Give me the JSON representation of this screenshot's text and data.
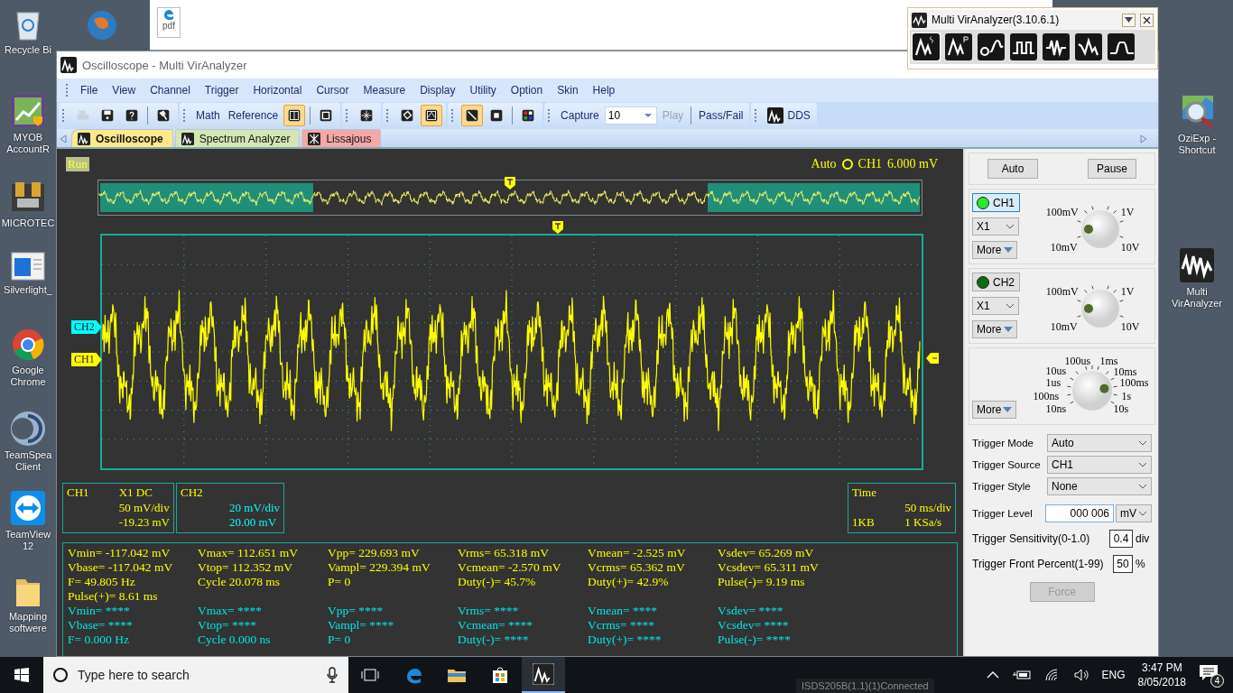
{
  "desktop": {
    "icons_left": [
      {
        "kind": "recycle",
        "label": "Recycle Bi"
      },
      {
        "kind": "chart",
        "label": "MYOB AccountR"
      },
      {
        "kind": "device",
        "label": "MICROTEC"
      },
      {
        "kind": "window",
        "label": "Silverlight_"
      },
      {
        "kind": "browser",
        "label": "Google Chrome"
      },
      {
        "kind": "headset",
        "label": "TeamSpea Client"
      },
      {
        "kind": "remote",
        "label": "TeamView 12"
      },
      {
        "kind": "folder",
        "label": "Mapping softwere"
      }
    ],
    "icons_right": [
      {
        "kind": "map",
        "label": "OziExp - Shortcut"
      },
      {
        "kind": "analyzer",
        "label": "Multi VirAnalyzer"
      }
    ],
    "file_icon": {
      "label": "pdf"
    }
  },
  "window": {
    "title": "Oscilloscope - Multi VirAnalyzer",
    "menu": [
      "File",
      "View",
      "Channel",
      "Trigger",
      "Horizontal",
      "Cursor",
      "Measure",
      "Display",
      "Utility",
      "Option",
      "Skin",
      "Help"
    ],
    "toolbar": [
      {
        "items": [
          {
            "kind": "icon",
            "pressed": false,
            "disabled": true
          },
          {
            "kind": "icon",
            "pressed": false,
            "disabled": false
          },
          {
            "kind": "icon",
            "pressed": false,
            "disabled": false
          },
          {
            "kind": "sep"
          },
          {
            "kind": "icon",
            "pressed": false,
            "disabled": false
          }
        ]
      },
      {
        "items": [
          {
            "kind": "text",
            "label": "Math",
            "disabled": false
          },
          {
            "kind": "text",
            "label": "Reference",
            "disabled": false
          },
          {
            "kind": "icon",
            "pressed": true,
            "disabled": false
          },
          {
            "kind": "sep"
          },
          {
            "kind": "icon",
            "pressed": false,
            "disabled": false
          }
        ]
      },
      {
        "items": [
          {
            "kind": "icon",
            "pressed": false,
            "disabled": false
          }
        ]
      },
      {
        "items": [
          {
            "kind": "icon",
            "pressed": false,
            "disabled": false
          },
          {
            "kind": "icon",
            "pressed": true,
            "disabled": false
          }
        ]
      },
      {
        "items": [
          {
            "kind": "icon",
            "pressed": true,
            "disabled": false
          },
          {
            "kind": "icon",
            "pressed": false,
            "disabled": false
          },
          {
            "kind": "sep"
          },
          {
            "kind": "icon",
            "pressed": false,
            "disabled": false
          }
        ]
      },
      {
        "items": [
          {
            "kind": "text",
            "label": "Capture",
            "disabled": false
          },
          {
            "kind": "input",
            "value": "10"
          },
          {
            "kind": "text",
            "label": "Play",
            "disabled": true
          },
          {
            "kind": "sep"
          },
          {
            "kind": "text",
            "label": "Pass/Fail",
            "disabled": false
          }
        ]
      },
      {
        "items": [
          {
            "kind": "icontext",
            "label": "DDS",
            "disabled": false
          }
        ]
      }
    ],
    "tabs": [
      {
        "label": "Oscilloscope",
        "selected": true,
        "color": "#fce98c"
      },
      {
        "label": "Spectrum Analyzer",
        "selected": false,
        "color": "#d4e6b5"
      },
      {
        "label": "Lissajous",
        "selected": false,
        "color": "#f4a8a8"
      }
    ],
    "scope": {
      "run_label": "Run",
      "trigger_mode": "Auto",
      "trigger_channel": "CH1",
      "trigger_value": "6.000 mV",
      "markers": [
        {
          "label": "CH2",
          "color": "#00ffff"
        },
        {
          "label": "CH1",
          "color": "#ffff00"
        }
      ],
      "channel_boxes": [
        {
          "title": "CH1",
          "coupling": "X1  DC",
          "scale": "50 mV/div",
          "offset": "-19.23 mV",
          "color": "#ffff00"
        },
        {
          "title": "CH2",
          "scale": "20 mV/div",
          "offset": "20.00 mV",
          "color": "#00ffff"
        }
      ],
      "time_box": {
        "title": "Time",
        "scale": "50 ms/div",
        "depth": "1KB",
        "rate": "1 KSa/s"
      },
      "measurements": [
        {
          "color": "#ffff00",
          "rows": [
            [
              "Vmin= -117.042 mV",
              "Vmax= 112.651 mV",
              "Vpp= 229.693 mV",
              "Vrms= 65.318 mV",
              "Vmean= -2.525 mV",
              "Vsdev= 65.269 mV"
            ],
            [
              "Vbase= -117.042 mV",
              "Vtop= 112.352 mV",
              "Vampl= 229.394 mV",
              "Vcmean= -2.570 mV",
              "Vcrms= 65.362 mV",
              "Vcsdev= 65.311 mV"
            ],
            [
              "F= 49.805 Hz",
              "Cycle 20.078 ms",
              "P= 0",
              "Duty(-)= 45.7%",
              "Duty(+)= 42.9%",
              "Pulse(-)= 9.19 ms"
            ],
            [
              "Pulse(+)= 8.61 ms"
            ]
          ]
        },
        {
          "color": "#00e8e8",
          "rows": [
            [
              "Vmin= ****",
              "Vmax= ****",
              "Vpp= ****",
              "Vrms= ****",
              "Vmean= ****",
              "Vsdev= ****"
            ],
            [
              "Vbase= ****",
              "Vtop= ****",
              "Vampl= ****",
              "Vcmean= ****",
              "Vcrms= ****",
              "Vcsdev= ****"
            ],
            [
              "F= 0.000 Hz",
              "Cycle 0.000 ns",
              "P= 0",
              "Duty(-)= ****",
              "Duty(+)= ****",
              "Pulse(-)= ****"
            ]
          ]
        }
      ]
    },
    "controls": {
      "auto": "Auto",
      "pause": "Pause",
      "channels": [
        {
          "label": "CH1",
          "selected": true,
          "probe": "X1",
          "more": "More",
          "knob": [
            "100mV",
            "1V",
            "10mV",
            "10V"
          ]
        },
        {
          "label": "CH2",
          "selected": false,
          "probe": "X1",
          "more": "More",
          "knob": [
            "100mV",
            "1V",
            "10mV",
            "10V"
          ]
        }
      ],
      "timebase": {
        "more": "More",
        "knob": [
          "100us",
          "1ms",
          "10us",
          "10ms",
          "1us",
          "100ms",
          "100ns",
          "1s",
          "10ns",
          "10s"
        ]
      },
      "trigger": {
        "selects": [
          {
            "label": "Trigger Mode",
            "value": "Auto"
          },
          {
            "label": "Trigger Source",
            "value": "CH1"
          },
          {
            "label": "Trigger Style",
            "value": "None"
          }
        ],
        "level": {
          "label": "Trigger Level",
          "value": "000 006",
          "unit": "mV"
        },
        "sensitivity": {
          "label": "Trigger Sensitivity(0-1.0)",
          "value": "0.4",
          "unit": "div"
        },
        "front": {
          "label": "Trigger Front Percent(1-99)",
          "value": "50",
          "unit": "%"
        },
        "force": {
          "label": "Force",
          "disabled": true
        }
      }
    }
  },
  "launcher": {
    "title": "Multi VirAnalyzer(3.10.6.1)",
    "tools": [
      {
        "selected": true
      },
      {
        "selected": false
      },
      {
        "selected": false
      },
      {
        "selected": false
      },
      {
        "selected": false
      },
      {
        "selected": false
      },
      {
        "selected": false
      }
    ]
  },
  "device_status": "ISDS205B(1.1)(1)Connected",
  "taskbar": {
    "search_placeholder": "Type here to search",
    "language": "ENG",
    "time": "3:47 PM",
    "date": "8/05/2018",
    "notifications": "4"
  }
}
